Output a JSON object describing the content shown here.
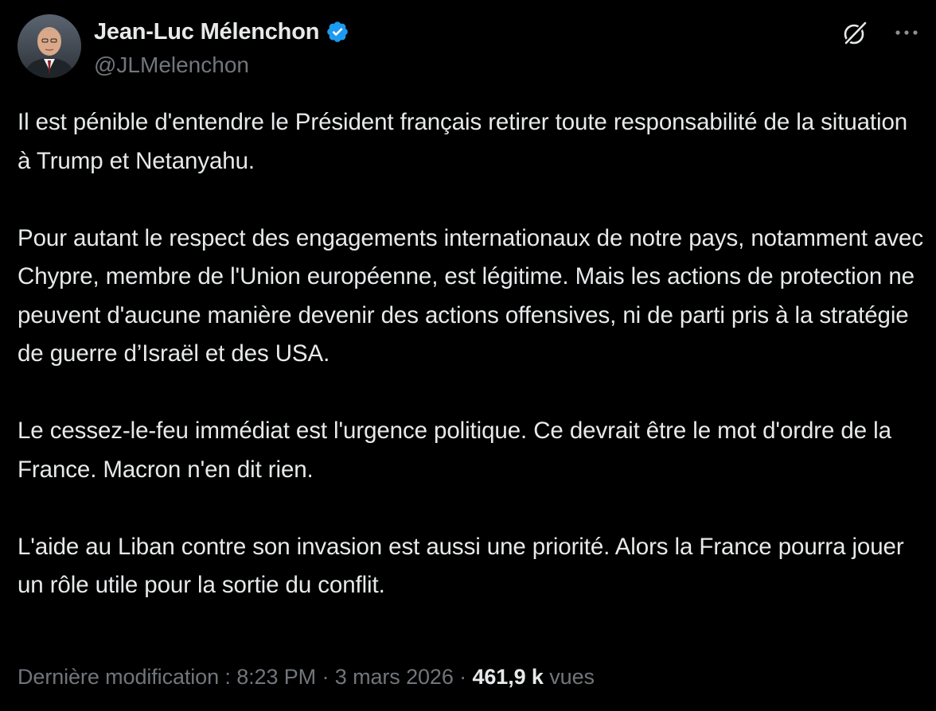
{
  "author": {
    "display_name": "Jean-Luc Mélenchon",
    "handle": "@JLMelenchon",
    "verified": true,
    "verified_color": "#1d9bf0"
  },
  "header_icons": {
    "grok": "grok-icon",
    "more": "more-options-icon"
  },
  "tweet": {
    "paragraphs": [
      "Il est pénible d'entendre le Président français retirer toute responsabilité de la situation à Trump et Netanyahu.",
      "Pour autant le respect des engagements internationaux de notre pays, notamment avec Chypre, membre de l'Union européenne, est légitime. Mais les actions de protection ne peuvent d'aucune manière devenir des actions offensives, ni de parti pris à la stratégie de guerre d’Israël et des USA.",
      "Le cessez-le-feu immédiat est l'urgence politique. Ce devrait être le mot d'ordre de la France. Macron n'en dit rien.",
      "L'aide au Liban contre son invasion est aussi une priorité. Alors la France pourra jouer un rôle utile pour la sortie du conflit."
    ]
  },
  "meta": {
    "edited_label": "Dernière modification : 8:23 PM",
    "separator_1": " · ",
    "date": "3 mars 2026",
    "separator_2": " · ",
    "views_count": "461,9 k",
    "views_label": " vues"
  },
  "colors": {
    "background": "#000000",
    "text_primary": "#e7e9ea",
    "text_secondary": "#71767b"
  }
}
